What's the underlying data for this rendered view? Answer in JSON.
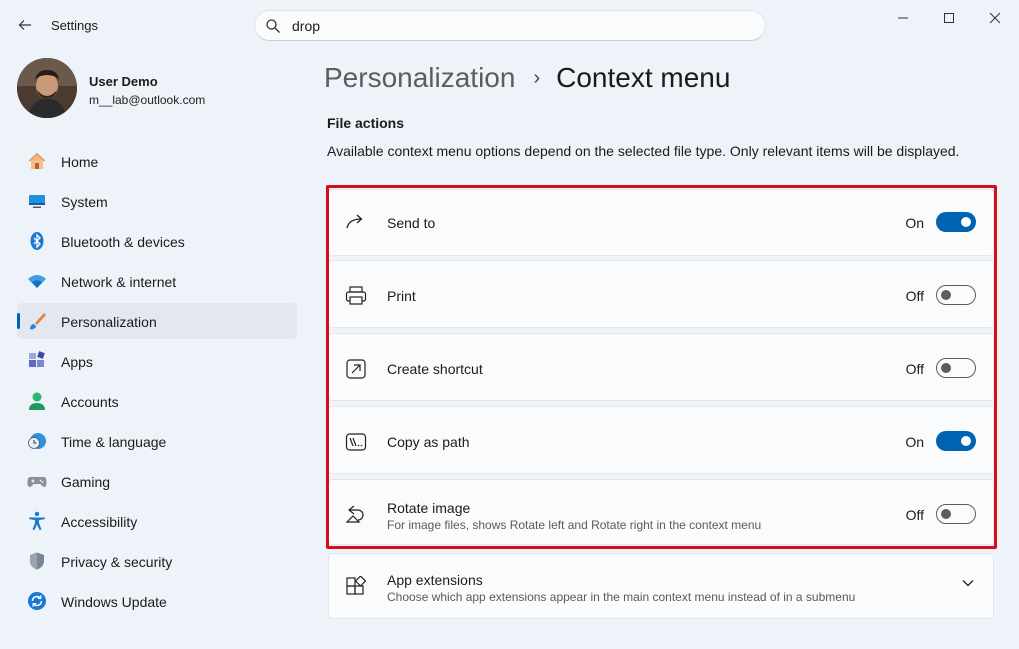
{
  "window": {
    "title": "Settings"
  },
  "search": {
    "value": "drop"
  },
  "profile": {
    "name": "User Demo",
    "email": "m__lab@outlook.com"
  },
  "sidebar": {
    "items": [
      {
        "label": "Home",
        "icon": "home-icon",
        "active": false
      },
      {
        "label": "System",
        "icon": "system-icon",
        "active": false
      },
      {
        "label": "Bluetooth & devices",
        "icon": "bluetooth-icon",
        "active": false
      },
      {
        "label": "Network & internet",
        "icon": "wifi-icon",
        "active": false
      },
      {
        "label": "Personalization",
        "icon": "brush-icon",
        "active": true
      },
      {
        "label": "Apps",
        "icon": "apps-icon",
        "active": false
      },
      {
        "label": "Accounts",
        "icon": "accounts-icon",
        "active": false
      },
      {
        "label": "Time & language",
        "icon": "clock-globe-icon",
        "active": false
      },
      {
        "label": "Gaming",
        "icon": "gamepad-icon",
        "active": false
      },
      {
        "label": "Accessibility",
        "icon": "accessibility-icon",
        "active": false
      },
      {
        "label": "Privacy & security",
        "icon": "shield-icon",
        "active": false
      },
      {
        "label": "Windows Update",
        "icon": "update-icon",
        "active": false
      }
    ]
  },
  "breadcrumb": {
    "parent": "Personalization",
    "separator": "›",
    "current": "Context menu"
  },
  "section": {
    "title": "File actions",
    "description": "Available context menu options depend on the selected file type. Only relevant items will be displayed."
  },
  "settings": [
    {
      "label": "Send to",
      "icon": "send-to-icon",
      "state": "On",
      "enabled": true
    },
    {
      "label": "Print",
      "icon": "printer-icon",
      "state": "Off",
      "enabled": false
    },
    {
      "label": "Create shortcut",
      "icon": "shortcut-icon",
      "state": "Off",
      "enabled": false
    },
    {
      "label": "Copy as path",
      "icon": "copy-path-icon",
      "state": "On",
      "enabled": true
    },
    {
      "label": "Rotate image",
      "sub": "For image files, shows Rotate left and Rotate right in the context menu",
      "icon": "rotate-icon",
      "state": "Off",
      "enabled": false
    }
  ],
  "extensions": {
    "label": "App extensions",
    "sub": "Choose which app extensions appear in the main context menu instead of in a submenu",
    "icon": "app-extensions-icon"
  },
  "colors": {
    "accent": "#0063b1",
    "highlight_border": "#d40e1a"
  }
}
